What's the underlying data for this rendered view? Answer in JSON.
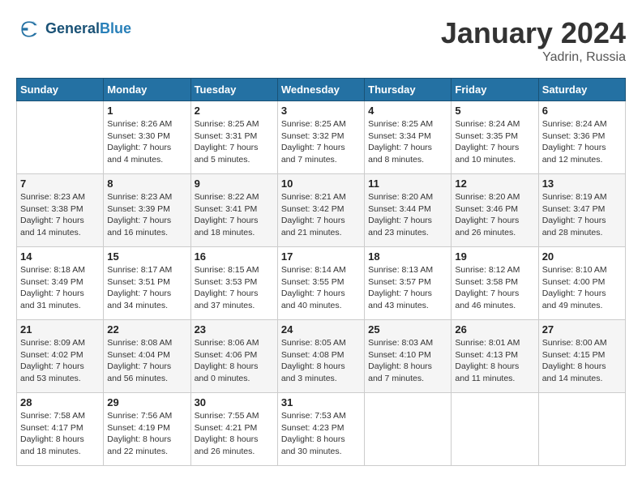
{
  "header": {
    "logo_line1": "General",
    "logo_line2": "Blue",
    "month_title": "January 2024",
    "location": "Yadrin, Russia"
  },
  "weekdays": [
    "Sunday",
    "Monday",
    "Tuesday",
    "Wednesday",
    "Thursday",
    "Friday",
    "Saturday"
  ],
  "weeks": [
    [
      {
        "day": "",
        "sunrise": "",
        "sunset": "",
        "daylight": ""
      },
      {
        "day": "1",
        "sunrise": "Sunrise: 8:26 AM",
        "sunset": "Sunset: 3:30 PM",
        "daylight": "Daylight: 7 hours and 4 minutes."
      },
      {
        "day": "2",
        "sunrise": "Sunrise: 8:25 AM",
        "sunset": "Sunset: 3:31 PM",
        "daylight": "Daylight: 7 hours and 5 minutes."
      },
      {
        "day": "3",
        "sunrise": "Sunrise: 8:25 AM",
        "sunset": "Sunset: 3:32 PM",
        "daylight": "Daylight: 7 hours and 7 minutes."
      },
      {
        "day": "4",
        "sunrise": "Sunrise: 8:25 AM",
        "sunset": "Sunset: 3:34 PM",
        "daylight": "Daylight: 7 hours and 8 minutes."
      },
      {
        "day": "5",
        "sunrise": "Sunrise: 8:24 AM",
        "sunset": "Sunset: 3:35 PM",
        "daylight": "Daylight: 7 hours and 10 minutes."
      },
      {
        "day": "6",
        "sunrise": "Sunrise: 8:24 AM",
        "sunset": "Sunset: 3:36 PM",
        "daylight": "Daylight: 7 hours and 12 minutes."
      }
    ],
    [
      {
        "day": "7",
        "sunrise": "Sunrise: 8:23 AM",
        "sunset": "Sunset: 3:38 PM",
        "daylight": "Daylight: 7 hours and 14 minutes."
      },
      {
        "day": "8",
        "sunrise": "Sunrise: 8:23 AM",
        "sunset": "Sunset: 3:39 PM",
        "daylight": "Daylight: 7 hours and 16 minutes."
      },
      {
        "day": "9",
        "sunrise": "Sunrise: 8:22 AM",
        "sunset": "Sunset: 3:41 PM",
        "daylight": "Daylight: 7 hours and 18 minutes."
      },
      {
        "day": "10",
        "sunrise": "Sunrise: 8:21 AM",
        "sunset": "Sunset: 3:42 PM",
        "daylight": "Daylight: 7 hours and 21 minutes."
      },
      {
        "day": "11",
        "sunrise": "Sunrise: 8:20 AM",
        "sunset": "Sunset: 3:44 PM",
        "daylight": "Daylight: 7 hours and 23 minutes."
      },
      {
        "day": "12",
        "sunrise": "Sunrise: 8:20 AM",
        "sunset": "Sunset: 3:46 PM",
        "daylight": "Daylight: 7 hours and 26 minutes."
      },
      {
        "day": "13",
        "sunrise": "Sunrise: 8:19 AM",
        "sunset": "Sunset: 3:47 PM",
        "daylight": "Daylight: 7 hours and 28 minutes."
      }
    ],
    [
      {
        "day": "14",
        "sunrise": "Sunrise: 8:18 AM",
        "sunset": "Sunset: 3:49 PM",
        "daylight": "Daylight: 7 hours and 31 minutes."
      },
      {
        "day": "15",
        "sunrise": "Sunrise: 8:17 AM",
        "sunset": "Sunset: 3:51 PM",
        "daylight": "Daylight: 7 hours and 34 minutes."
      },
      {
        "day": "16",
        "sunrise": "Sunrise: 8:15 AM",
        "sunset": "Sunset: 3:53 PM",
        "daylight": "Daylight: 7 hours and 37 minutes."
      },
      {
        "day": "17",
        "sunrise": "Sunrise: 8:14 AM",
        "sunset": "Sunset: 3:55 PM",
        "daylight": "Daylight: 7 hours and 40 minutes."
      },
      {
        "day": "18",
        "sunrise": "Sunrise: 8:13 AM",
        "sunset": "Sunset: 3:57 PM",
        "daylight": "Daylight: 7 hours and 43 minutes."
      },
      {
        "day": "19",
        "sunrise": "Sunrise: 8:12 AM",
        "sunset": "Sunset: 3:58 PM",
        "daylight": "Daylight: 7 hours and 46 minutes."
      },
      {
        "day": "20",
        "sunrise": "Sunrise: 8:10 AM",
        "sunset": "Sunset: 4:00 PM",
        "daylight": "Daylight: 7 hours and 49 minutes."
      }
    ],
    [
      {
        "day": "21",
        "sunrise": "Sunrise: 8:09 AM",
        "sunset": "Sunset: 4:02 PM",
        "daylight": "Daylight: 7 hours and 53 minutes."
      },
      {
        "day": "22",
        "sunrise": "Sunrise: 8:08 AM",
        "sunset": "Sunset: 4:04 PM",
        "daylight": "Daylight: 7 hours and 56 minutes."
      },
      {
        "day": "23",
        "sunrise": "Sunrise: 8:06 AM",
        "sunset": "Sunset: 4:06 PM",
        "daylight": "Daylight: 8 hours and 0 minutes."
      },
      {
        "day": "24",
        "sunrise": "Sunrise: 8:05 AM",
        "sunset": "Sunset: 4:08 PM",
        "daylight": "Daylight: 8 hours and 3 minutes."
      },
      {
        "day": "25",
        "sunrise": "Sunrise: 8:03 AM",
        "sunset": "Sunset: 4:10 PM",
        "daylight": "Daylight: 8 hours and 7 minutes."
      },
      {
        "day": "26",
        "sunrise": "Sunrise: 8:01 AM",
        "sunset": "Sunset: 4:13 PM",
        "daylight": "Daylight: 8 hours and 11 minutes."
      },
      {
        "day": "27",
        "sunrise": "Sunrise: 8:00 AM",
        "sunset": "Sunset: 4:15 PM",
        "daylight": "Daylight: 8 hours and 14 minutes."
      }
    ],
    [
      {
        "day": "28",
        "sunrise": "Sunrise: 7:58 AM",
        "sunset": "Sunset: 4:17 PM",
        "daylight": "Daylight: 8 hours and 18 minutes."
      },
      {
        "day": "29",
        "sunrise": "Sunrise: 7:56 AM",
        "sunset": "Sunset: 4:19 PM",
        "daylight": "Daylight: 8 hours and 22 minutes."
      },
      {
        "day": "30",
        "sunrise": "Sunrise: 7:55 AM",
        "sunset": "Sunset: 4:21 PM",
        "daylight": "Daylight: 8 hours and 26 minutes."
      },
      {
        "day": "31",
        "sunrise": "Sunrise: 7:53 AM",
        "sunset": "Sunset: 4:23 PM",
        "daylight": "Daylight: 8 hours and 30 minutes."
      },
      {
        "day": "",
        "sunrise": "",
        "sunset": "",
        "daylight": ""
      },
      {
        "day": "",
        "sunrise": "",
        "sunset": "",
        "daylight": ""
      },
      {
        "day": "",
        "sunrise": "",
        "sunset": "",
        "daylight": ""
      }
    ]
  ]
}
